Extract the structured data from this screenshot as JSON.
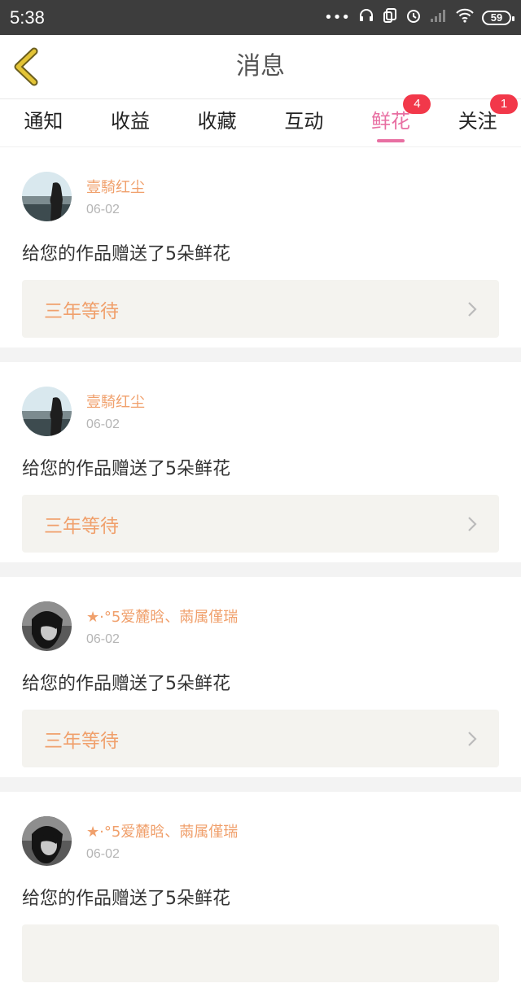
{
  "status": {
    "time": "5:38",
    "battery": "59"
  },
  "header": {
    "title": "消息"
  },
  "tabs": [
    {
      "label": "通知",
      "badge": ""
    },
    {
      "label": "收益",
      "badge": ""
    },
    {
      "label": "收藏",
      "badge": ""
    },
    {
      "label": "互动",
      "badge": ""
    },
    {
      "label": "鲜花",
      "badge": "4"
    },
    {
      "label": "关注",
      "badge": "1"
    }
  ],
  "active_tab": "鲜花",
  "messages": [
    {
      "user": "壹騎红尘",
      "date": "06-02",
      "text": "给您的作品赠送了5朵鲜花",
      "work": "三年等待",
      "avatar": "landscape"
    },
    {
      "user": "壹騎红尘",
      "date": "06-02",
      "text": "给您的作品赠送了5朵鲜花",
      "work": "三年等待",
      "avatar": "landscape"
    },
    {
      "user": "★·°5爱麓晗、䓣属僅瑞",
      "date": "06-02",
      "text": "给您的作品赠送了5朵鲜花",
      "work": "三年等待",
      "avatar": "portrait"
    },
    {
      "user": "★·°5爱麓晗、䓣属僅瑞",
      "date": "06-02",
      "text": "给您的作品赠送了5朵鲜花",
      "work": "",
      "avatar": "portrait"
    }
  ],
  "colors": {
    "accent": "#e86fa2",
    "badge": "#f2384a",
    "username": "#f0a06c",
    "back_arrow": "#e3c436"
  }
}
